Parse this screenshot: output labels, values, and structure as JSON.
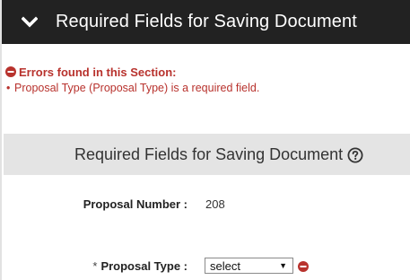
{
  "header": {
    "title": "Required Fields for Saving Document",
    "icon": "chevron-down-icon"
  },
  "errors": {
    "heading": "Errors found in this Section:",
    "items": [
      "Proposal Type (Proposal Type) is a required field."
    ],
    "color": "#b8322d"
  },
  "section": {
    "title": "Required Fields for Saving Document",
    "help_icon": "help-circle-icon"
  },
  "fields": {
    "proposal_number": {
      "label": "Proposal Number :",
      "value": "208"
    },
    "proposal_type": {
      "required_marker": "*",
      "label": "Proposal Type :",
      "selected": "select",
      "error_icon": "error-minus-icon"
    }
  },
  "colors": {
    "header_bg": "#222222",
    "section_bg": "#e4e4e4",
    "error": "#b8322d"
  }
}
